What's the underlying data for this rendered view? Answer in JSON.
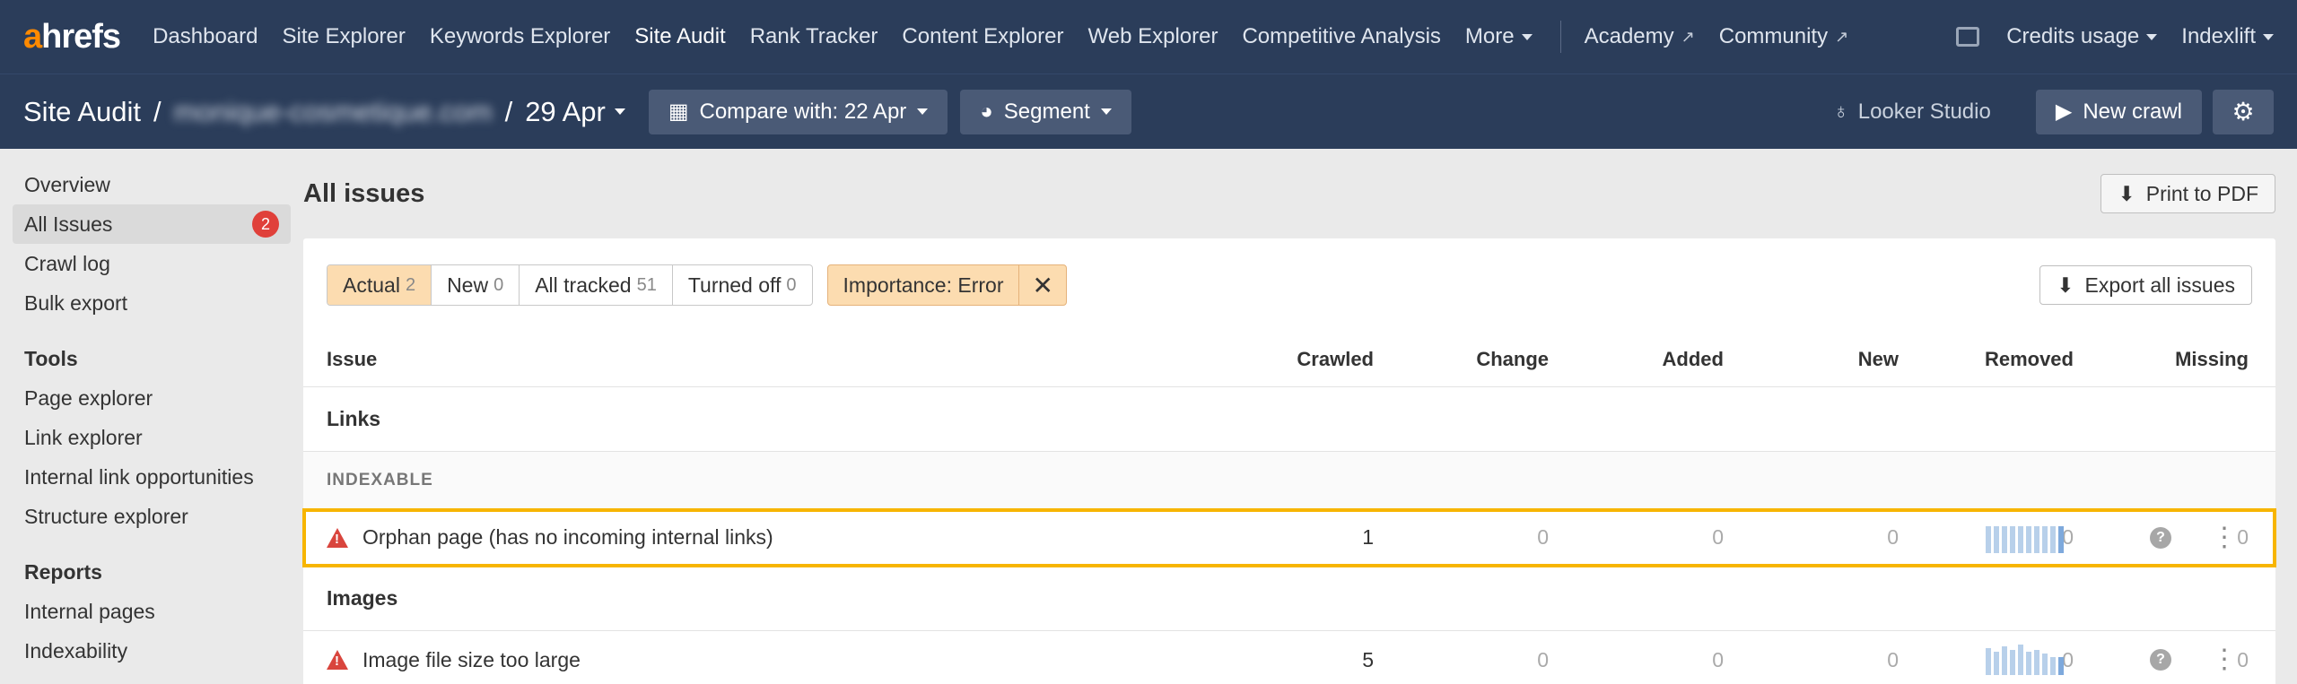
{
  "nav": {
    "logo_a": "a",
    "logo_rest": "hrefs",
    "items": [
      {
        "label": "Dashboard"
      },
      {
        "label": "Site Explorer"
      },
      {
        "label": "Keywords Explorer"
      },
      {
        "label": "Site Audit",
        "active": true
      },
      {
        "label": "Rank Tracker"
      },
      {
        "label": "Content Explorer"
      },
      {
        "label": "Web Explorer"
      },
      {
        "label": "Competitive Analysis"
      }
    ],
    "more": "More",
    "academy": "Academy",
    "community": "Community",
    "credits": "Credits usage",
    "account": "Indexlift"
  },
  "subhead": {
    "title": "Site Audit",
    "sep": "/",
    "domain": "monique-cosmetique.com",
    "date": "29 Apr",
    "compare": "Compare with: 22 Apr",
    "segment": "Segment",
    "looker": "Looker Studio",
    "new_crawl": "New crawl"
  },
  "sidebar": {
    "items": [
      {
        "label": "Overview"
      },
      {
        "label": "All Issues",
        "badge": "2"
      },
      {
        "label": "Crawl log"
      },
      {
        "label": "Bulk export"
      }
    ],
    "tools_head": "Tools",
    "tools": [
      {
        "label": "Page explorer"
      },
      {
        "label": "Link explorer"
      },
      {
        "label": "Internal link opportunities"
      },
      {
        "label": "Structure explorer"
      }
    ],
    "reports_head": "Reports",
    "reports": [
      {
        "label": "Internal pages"
      },
      {
        "label": "Indexability"
      }
    ]
  },
  "main": {
    "title": "All issues",
    "print": "Print to PDF",
    "export": "Export all issues",
    "filters": [
      {
        "label": "Actual",
        "count": "2"
      },
      {
        "label": "New",
        "count": "0"
      },
      {
        "label": "All tracked",
        "count": "51"
      },
      {
        "label": "Turned off",
        "count": "0"
      }
    ],
    "importance": "Importance: Error",
    "columns": [
      "Issue",
      "Crawled",
      "Change",
      "Added",
      "New",
      "Removed",
      "Missing"
    ],
    "sections": {
      "links": "Links",
      "indexable": "INDEXABLE",
      "images": "Images"
    },
    "rows": [
      {
        "issue": "Orphan page (has no incoming internal links)",
        "crawled": "1",
        "change": "0",
        "added": "0",
        "new": "0",
        "removed": "0",
        "missing": "0"
      },
      {
        "issue": "Image file size too large",
        "crawled": "5",
        "change": "0",
        "added": "0",
        "new": "0",
        "removed": "0",
        "missing": "0"
      }
    ]
  },
  "colors": {
    "nav_bg": "#2b3d5a",
    "accent": "#ff8a00",
    "highlight": "#f7b500",
    "error": "#d9453d",
    "filter_active": "#fcdcb0"
  }
}
